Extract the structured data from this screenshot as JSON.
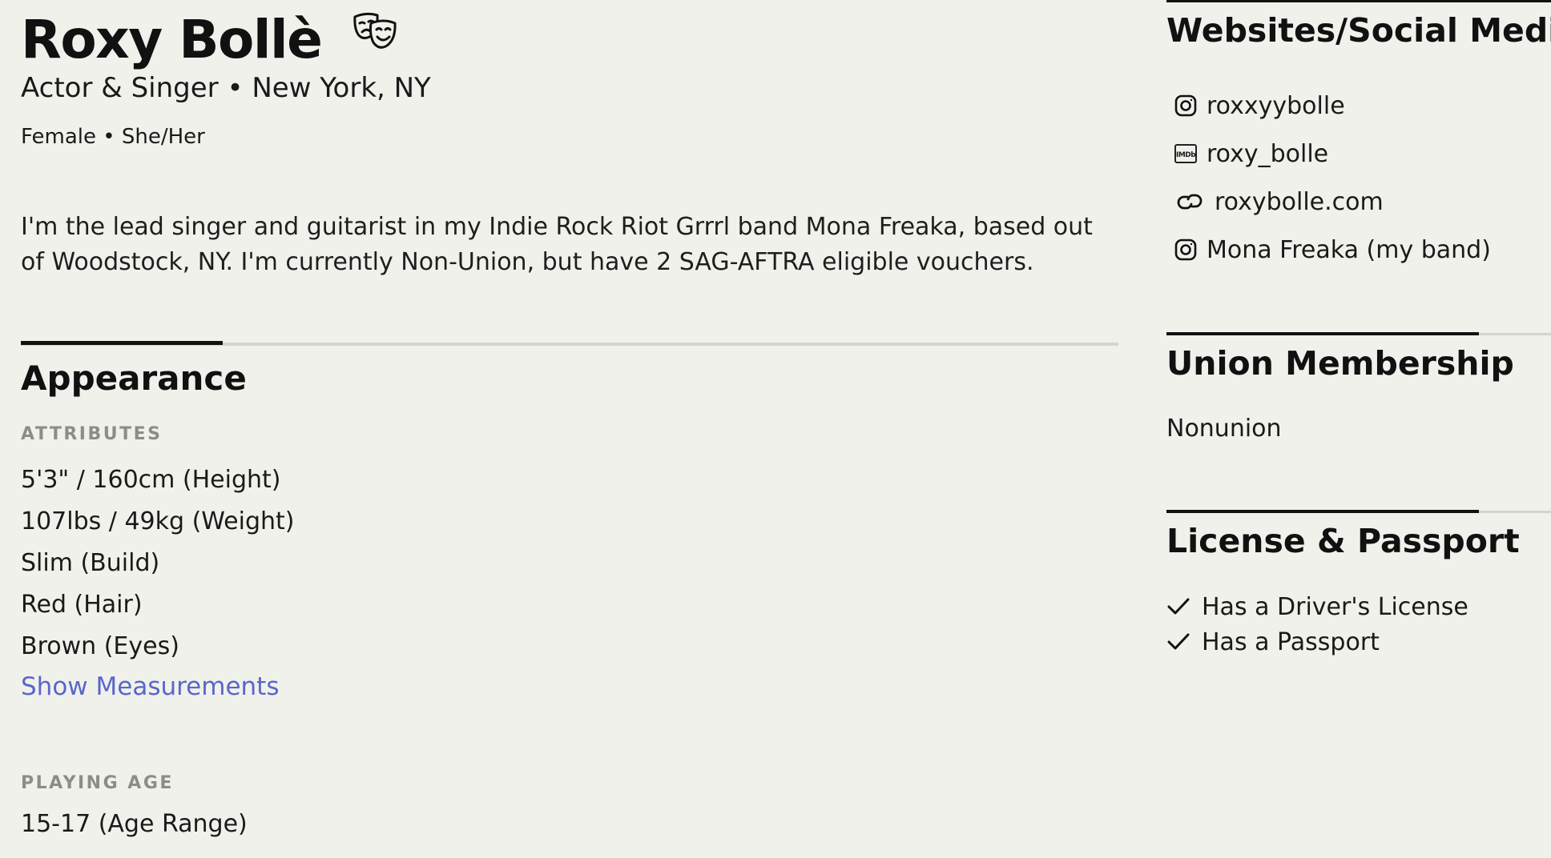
{
  "profile": {
    "name": "Roxy Bollè",
    "subtitle": "Actor & Singer • New York, NY",
    "gender_pronouns": "Female • She/Her",
    "bio": "I'm the lead singer and guitarist in my Indie Rock Riot Grrrl band Mona Freaka, based out of Woodstock, NY. I'm currently Non-Union, but have 2 SAG-AFTRA eligible vouchers.",
    "icon": "theater-masks-icon"
  },
  "appearance": {
    "title": "Appearance",
    "attributes_label": "ATTRIBUTES",
    "attributes": [
      "5'3\" / 160cm (Height)",
      "107lbs / 49kg (Weight)",
      "Slim (Build)",
      "Red (Hair)",
      "Brown (Eyes)"
    ],
    "show_measurements_label": "Show Measurements",
    "playing_age_label": "PLAYING AGE",
    "playing_age": "15-17 (Age Range)"
  },
  "websites": {
    "title": "Websites/Social Media",
    "items": [
      {
        "icon": "instagram-icon",
        "label": "roxxyybolle"
      },
      {
        "icon": "imdb-icon",
        "label": "roxy_bolle",
        "icon_text": "IMDb"
      },
      {
        "icon": "link-icon",
        "label": "roxybolle.com"
      },
      {
        "icon": "instagram-icon",
        "label": "Mona Freaka (my band)"
      }
    ]
  },
  "union": {
    "title": "Union Membership",
    "value": "Nonunion"
  },
  "license": {
    "title": "License & Passport",
    "items": [
      {
        "icon": "checkmark-icon",
        "label": "Has a Driver's License"
      },
      {
        "icon": "checkmark-icon",
        "label": "Has a Passport"
      }
    ]
  },
  "colors": {
    "background": "#f1f1ec",
    "text": "#111111",
    "muted_label": "#8c8c8a",
    "link": "#5a67c9",
    "divider": "#d5d5d0"
  }
}
